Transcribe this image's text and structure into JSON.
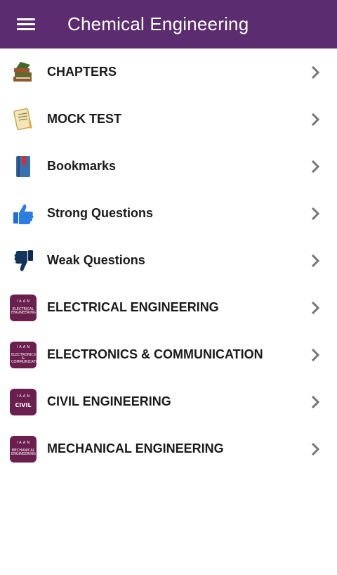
{
  "app": {
    "title": "Chemical Engineering"
  },
  "menu": [
    {
      "label": "CHAPTERS",
      "icon": "books-icon"
    },
    {
      "label": "MOCK TEST",
      "icon": "notepad-icon"
    },
    {
      "label": "Bookmarks",
      "icon": "bookmark-book-icon"
    },
    {
      "label": "Strong Questions",
      "icon": "thumbs-up-icon"
    },
    {
      "label": "Weak Questions",
      "icon": "thumbs-down-icon"
    },
    {
      "label": "ELECTRICAL ENGINEERING",
      "icon": "electrical-app-icon"
    },
    {
      "label": "ELECTRONICS & COMMUNICATION",
      "icon": "electronics-app-icon"
    },
    {
      "label": "CIVIL ENGINEERING",
      "icon": "civil-app-icon"
    },
    {
      "label": "MECHANICAL ENGINEERING",
      "icon": "mechanical-app-icon"
    }
  ],
  "badges": {
    "electrical": {
      "top": "I A A N",
      "bottom": "ELECTRICAL ENGINEERING"
    },
    "electronics": {
      "top": "I A A N",
      "bottom": "ELECTRONICS & COMMUNICATION"
    },
    "civil": {
      "top": "I A A N",
      "bottom": "CIVIL"
    },
    "mechanical": {
      "top": "I A A N",
      "bottom": "MECHANICAL ENGINEERING"
    }
  },
  "colors": {
    "appbar": "#5b2c6f",
    "badge": "#6b1f4e",
    "chevron": "#757575"
  }
}
